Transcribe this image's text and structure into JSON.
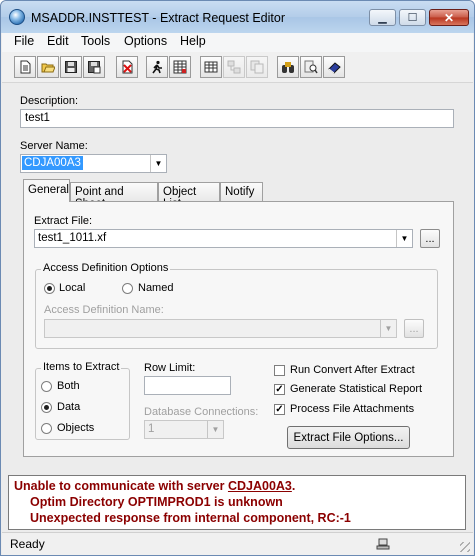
{
  "window": {
    "title": "MSADDR.INSTTEST - Extract Request Editor"
  },
  "menu": [
    "File",
    "Edit",
    "Tools",
    "Options",
    "Help"
  ],
  "toolbar": [
    {
      "icon": "new-document-icon"
    },
    {
      "icon": "open-folder-icon"
    },
    {
      "icon": "save-icon"
    },
    {
      "icon": "save-as-icon"
    },
    {
      "icon": "delete-icon"
    },
    {
      "icon": "run-icon"
    },
    {
      "icon": "table-icon"
    },
    {
      "icon": "table-editor-icon"
    },
    {
      "icon": "relationships-icon"
    },
    {
      "icon": "copy-icon"
    },
    {
      "icon": "binoculars-icon"
    },
    {
      "icon": "search-icon"
    },
    {
      "icon": "book-icon"
    }
  ],
  "description": {
    "label": "Description:",
    "value": "test1"
  },
  "server": {
    "label": "Server Name:",
    "value": "CDJA00A3"
  },
  "tabs": [
    "General",
    "Point and Shoot",
    "Object List",
    "Notify"
  ],
  "extract_file": {
    "label": "Extract File:",
    "value": "test1_1011.xf",
    "browse": "..."
  },
  "access_def": {
    "title": "Access Definition Options",
    "local": "Local",
    "named": "Named",
    "name_label": "Access Definition Name:",
    "browse": "..."
  },
  "items": {
    "title": "Items to Extract",
    "both": "Both",
    "data": "Data",
    "objects": "Objects"
  },
  "row_limit": {
    "label": "Row Limit:",
    "value": ""
  },
  "db_connections": {
    "label": "Database Connections:",
    "value": "1"
  },
  "options": {
    "run_convert": "Run Convert After Extract",
    "gen_stats": "Generate Statistical Report",
    "process_attach": "Process File Attachments",
    "extract_options_btn": "Extract File Options..."
  },
  "messages": {
    "line1_prefix": "Unable to communicate with server ",
    "line1_server": "CDJA00A3",
    "line1_suffix": ".",
    "line2": "Optim Directory OPTIMPROD1 is unknown",
    "line3": "Unexpected response from internal component, RC:-1"
  },
  "status": {
    "text": "Ready"
  },
  "colors": {
    "error": "#8b0000",
    "selection": "#3399ff"
  }
}
